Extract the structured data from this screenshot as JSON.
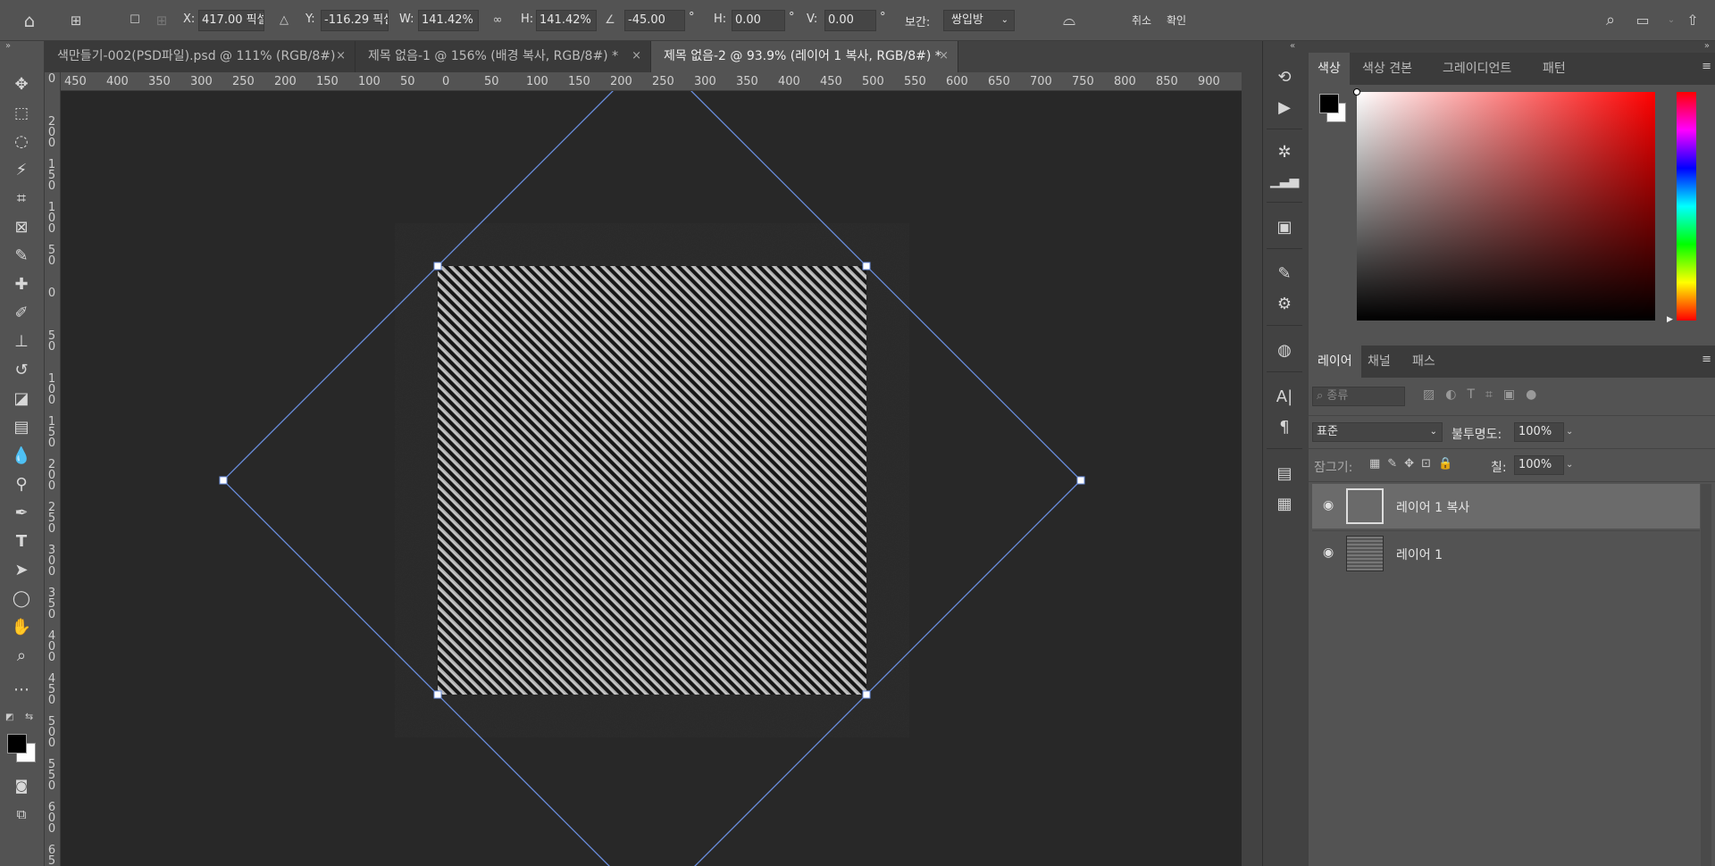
{
  "options_bar": {
    "x_label": "X:",
    "x_value": "417.00 픽셀",
    "y_label": "Y:",
    "y_value": "-116.29 픽셀",
    "w_label": "W:",
    "w_value": "141.42%",
    "h_label": "H:",
    "h_value": "141.42%",
    "angle_value": "-45.00",
    "degree1": "°",
    "skew_h_label": "H:",
    "skew_h_value": "0.00",
    "degree2": "°",
    "skew_v_label": "V:",
    "skew_v_value": "0.00",
    "degree3": "°",
    "interp_label": "보간:",
    "interp_value": "쌍입방",
    "cancel_label": "취소",
    "commit_label": "확인"
  },
  "tabs": [
    {
      "label": "색만들기-002(PSD파일).psd @ 111% (RGB/8#)",
      "close": "×"
    },
    {
      "label": "제목 없음-1 @ 156% (배경 복사, RGB/8#) *",
      "close": "×"
    },
    {
      "label": "제목 없음-2 @ 93.9% (레이어 1 복사, RGB/8#) *",
      "close": "×"
    }
  ],
  "ruler_h": [
    "450",
    "400",
    "350",
    "300",
    "250",
    "200",
    "150",
    "100",
    "50",
    "0",
    "50",
    "100",
    "150",
    "200",
    "250",
    "300",
    "350",
    "400",
    "450",
    "500",
    "550",
    "600",
    "650",
    "700",
    "750",
    "800",
    "850",
    "900"
  ],
  "ruler_v": [
    "0",
    "2\n0\n0",
    "1\n5\n0",
    "1\n0\n0",
    "5\n0",
    "0",
    "5\n0",
    "1\n0\n0",
    "1\n5\n0",
    "2\n0\n0",
    "2\n5\n0",
    "3\n0\n0",
    "3\n5\n0",
    "4\n0\n0",
    "4\n5\n0",
    "5\n0\n0",
    "5\n5\n0",
    "6\n0\n0",
    "6\n5\n0",
    "7"
  ],
  "color_panel": {
    "tabs": [
      "색상",
      "색상 견본",
      "그레이디언트",
      "패턴"
    ],
    "foreground": "#000000",
    "background": "#ffffff",
    "hue": "#ff0000"
  },
  "layers_panel": {
    "tabs": [
      "레이어",
      "채널",
      "패스"
    ],
    "filter_placeholder": "종류",
    "blend_mode": "표준",
    "opacity_label": "불투명도:",
    "opacity_value": "100%",
    "lock_label": "잠그기:",
    "fill_label": "칠:",
    "fill_value": "100%",
    "layers": [
      {
        "name": "레이어 1 복사",
        "selected": true
      },
      {
        "name": "레이어 1",
        "selected": false
      }
    ]
  },
  "colors": {
    "transform_line": "#6b8fe0",
    "panel_bg": "#535353"
  }
}
